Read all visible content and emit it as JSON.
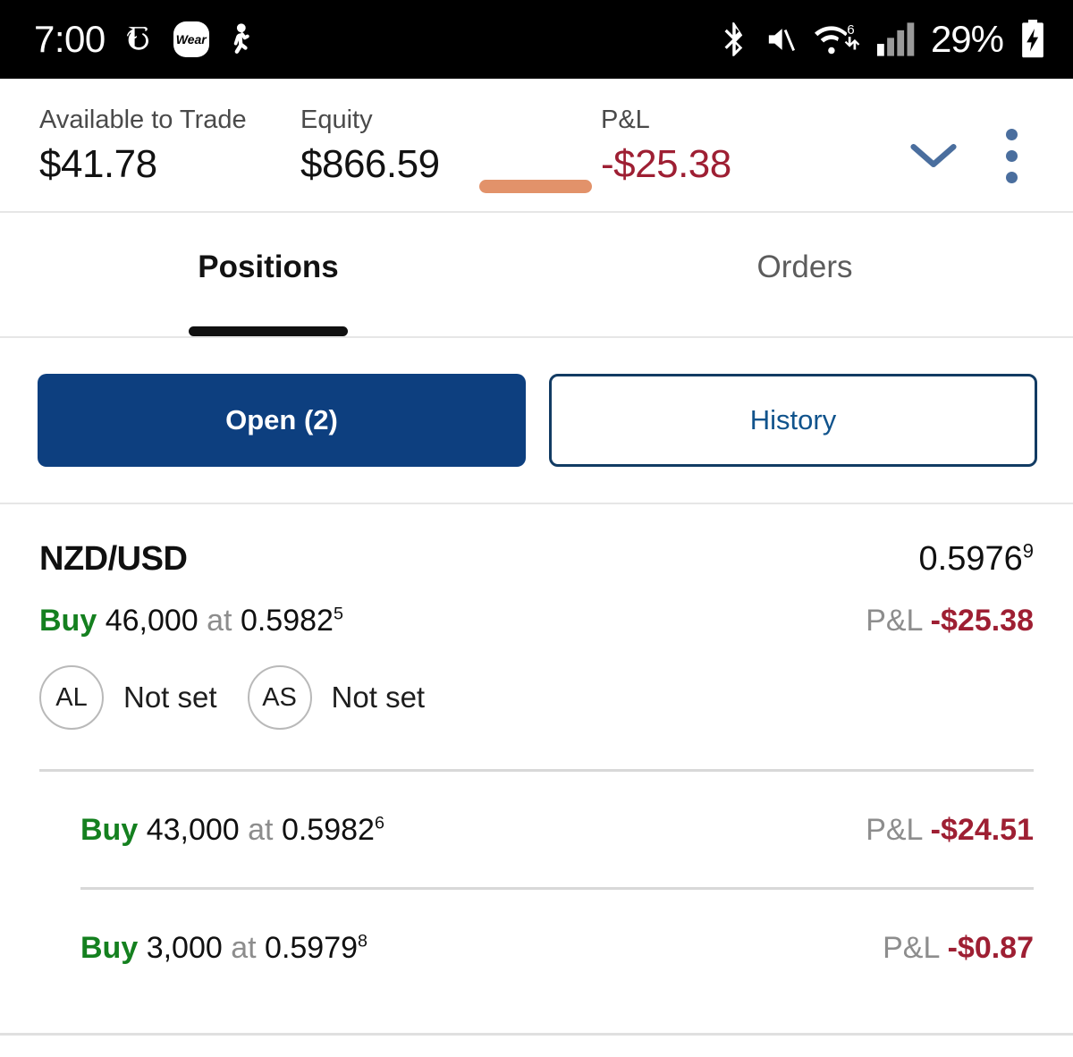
{
  "status_bar": {
    "time": "7:00",
    "icons_left": [
      "nyt-icon",
      "wear-icon",
      "samsung-health-icon"
    ],
    "nyt_glyph": "T",
    "wear_label": "Wear",
    "icons_right": [
      "bluetooth-icon",
      "volume-muted-icon",
      "wifi-6-icon",
      "cellular-signal-icon"
    ],
    "battery_percent": "29%",
    "battery_state": "charging"
  },
  "summary": {
    "available_label": "Available to Trade",
    "available_value": "$41.78",
    "equity_label": "Equity",
    "equity_value": "$866.59",
    "pnl_label": "P&L",
    "pnl_value": "-$25.38",
    "collapse_icon": "chevron-down-icon",
    "overflow_icon": "kebab-menu-icon",
    "drag_handle_color": "#e2926a"
  },
  "tabs": [
    {
      "label": "Positions",
      "active": true
    },
    {
      "label": "Orders",
      "active": false
    }
  ],
  "filters": [
    {
      "label": "Open (2)",
      "style": "primary"
    },
    {
      "label": "History",
      "style": "secondary"
    }
  ],
  "position": {
    "symbol": "NZD/USD",
    "current_price": "0.5976",
    "current_price_pip": "9",
    "aggregate": {
      "side": "Buy",
      "quantity": "46,000",
      "at_label": "at",
      "rate": "0.5982",
      "rate_pip": "5",
      "pnl_label": "P&L",
      "pnl_value": "-$25.38"
    },
    "orders": [
      {
        "code": "AL",
        "name": "add-limit",
        "status": "Not set"
      },
      {
        "code": "AS",
        "name": "add-stop",
        "status": "Not set"
      }
    ],
    "legs": [
      {
        "side": "Buy",
        "quantity": "43,000",
        "at_label": "at",
        "rate": "0.5982",
        "rate_pip": "6",
        "pnl_label": "P&L",
        "pnl_value": "-$24.51"
      },
      {
        "side": "Buy",
        "quantity": "3,000",
        "at_label": "at",
        "rate": "0.5979",
        "rate_pip": "8",
        "pnl_label": "P&L",
        "pnl_value": "-$0.87"
      }
    ]
  },
  "colors": {
    "buy_green": "#14801f",
    "loss_red": "#9e1f33",
    "primary_blue": "#0d3f7f",
    "accent_blue": "#4a6e9e"
  }
}
